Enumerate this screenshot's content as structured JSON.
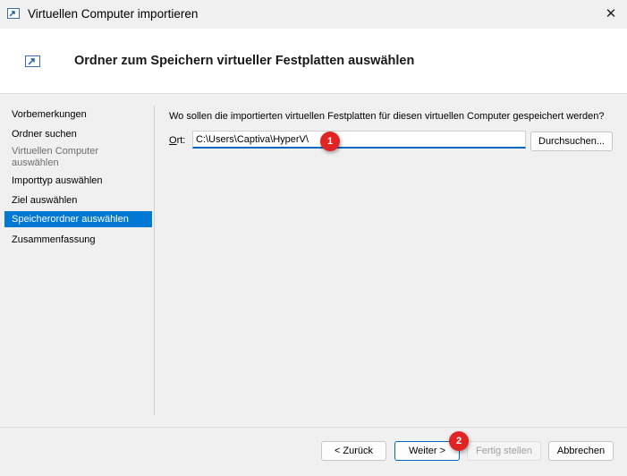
{
  "window": {
    "title": "Virtuellen Computer importieren",
    "close_glyph": "✕"
  },
  "header": {
    "title": "Ordner zum Speichern virtueller Festplatten auswählen",
    "icon": "import-vm-icon"
  },
  "sidebar": {
    "items": [
      {
        "label": "Vorbemerkungen",
        "state": "normal"
      },
      {
        "label": "Ordner suchen",
        "state": "normal"
      },
      {
        "label": "Virtuellen Computer auswählen",
        "state": "disabled"
      },
      {
        "label": "Importtyp auswählen",
        "state": "normal"
      },
      {
        "label": "Ziel auswählen",
        "state": "normal"
      },
      {
        "label": "Speicherordner auswählen",
        "state": "active"
      },
      {
        "label": "Zusammenfassung",
        "state": "normal"
      }
    ]
  },
  "main": {
    "question": "Wo sollen die importierten virtuellen Festplatten für diesen virtuellen Computer gespeichert werden?",
    "location_label_prefix": "O",
    "location_label_rest": "rt:",
    "location_value": "C:\\Users\\Captiva\\HyperV\\",
    "browse_label": "Durchsuchen..."
  },
  "footer": {
    "back_label": "< Zurück",
    "next_label": "Weiter >",
    "finish_label": "Fertig stellen",
    "cancel_label": "Abbrechen"
  },
  "markers": [
    "1",
    "2"
  ],
  "colors": {
    "accent": "#0078d4",
    "marker": "#e02323"
  }
}
